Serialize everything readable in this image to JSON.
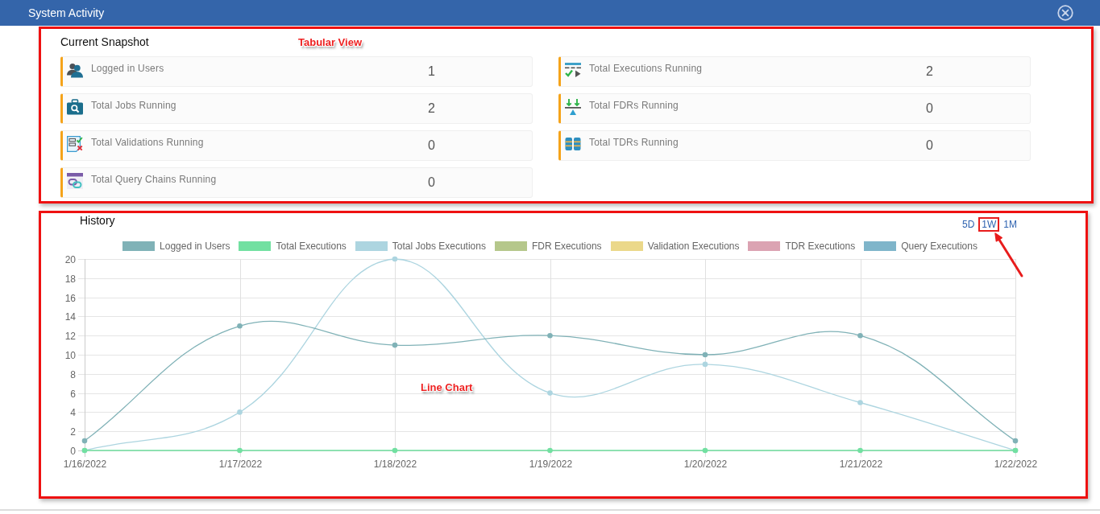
{
  "window": {
    "title": "System Activity"
  },
  "snapshot": {
    "title": "Current Snapshot",
    "annotation": "Tabular View",
    "cards": [
      {
        "label": "Logged in Users",
        "value": "1"
      },
      {
        "label": "Total Executions Running",
        "value": "2"
      },
      {
        "label": "Total Jobs Running",
        "value": "2"
      },
      {
        "label": "Total FDRs Running",
        "value": "0"
      },
      {
        "label": "Total Validations Running",
        "value": "0"
      },
      {
        "label": "Total TDRs Running",
        "value": "0"
      },
      {
        "label": "Total Query Chains Running",
        "value": "0"
      }
    ]
  },
  "history": {
    "title": "History",
    "annotation": "Line Chart",
    "ranges": [
      {
        "label": "5D",
        "highlighted": false
      },
      {
        "label": "1W",
        "highlighted": true
      },
      {
        "label": "1M",
        "highlighted": false
      }
    ],
    "chart_data": {
      "type": "line",
      "grid": true,
      "legend": "top",
      "categories": [
        "1/16/2022",
        "1/17/2022",
        "1/18/2022",
        "1/19/2022",
        "1/20/2022",
        "1/21/2022",
        "1/22/2022"
      ],
      "series": [
        {
          "name": "Logged in Users",
          "color": "#80b2b7",
          "marker": "circle",
          "values": [
            1,
            13,
            11,
            12,
            10,
            12,
            1
          ]
        },
        {
          "name": "Total Executions",
          "color": "#72e0a1",
          "marker": "circle",
          "values": [
            0,
            0,
            0,
            0,
            0,
            0,
            0
          ]
        },
        {
          "name": "Total Jobs Executions",
          "color": "#add5e0",
          "marker": "circle",
          "values": [
            0,
            4,
            20,
            6,
            9,
            5,
            0
          ]
        },
        {
          "name": "FDR Executions",
          "color": "#b5c78b",
          "values": [
            null,
            null,
            null,
            null,
            null,
            null,
            null
          ]
        },
        {
          "name": "Validation Executions",
          "color": "#ebd88a",
          "values": [
            null,
            null,
            null,
            null,
            null,
            null,
            null
          ]
        },
        {
          "name": "TDR Executions",
          "color": "#dba3b2",
          "values": [
            null,
            null,
            null,
            null,
            null,
            null,
            null
          ]
        },
        {
          "name": "Query Executions",
          "color": "#7fb5ca",
          "values": [
            null,
            null,
            null,
            null,
            null,
            null,
            null
          ]
        }
      ],
      "ylim": [
        0,
        20
      ],
      "yticks": [
        {
          "value": 0,
          "label": "0"
        },
        {
          "value": 2,
          "label": "2"
        },
        {
          "value": 4,
          "label": "4"
        },
        {
          "value": 6,
          "label": "6"
        },
        {
          "value": 8,
          "label": "8"
        },
        {
          "value": 10,
          "label": "10"
        },
        {
          "value": 12,
          "label": "12"
        },
        {
          "value": 14,
          "label": "14"
        },
        {
          "value": 16,
          "label": "16"
        },
        {
          "value": 18,
          "label": "18"
        },
        {
          "value": 20,
          "label": "20"
        }
      ]
    }
  }
}
